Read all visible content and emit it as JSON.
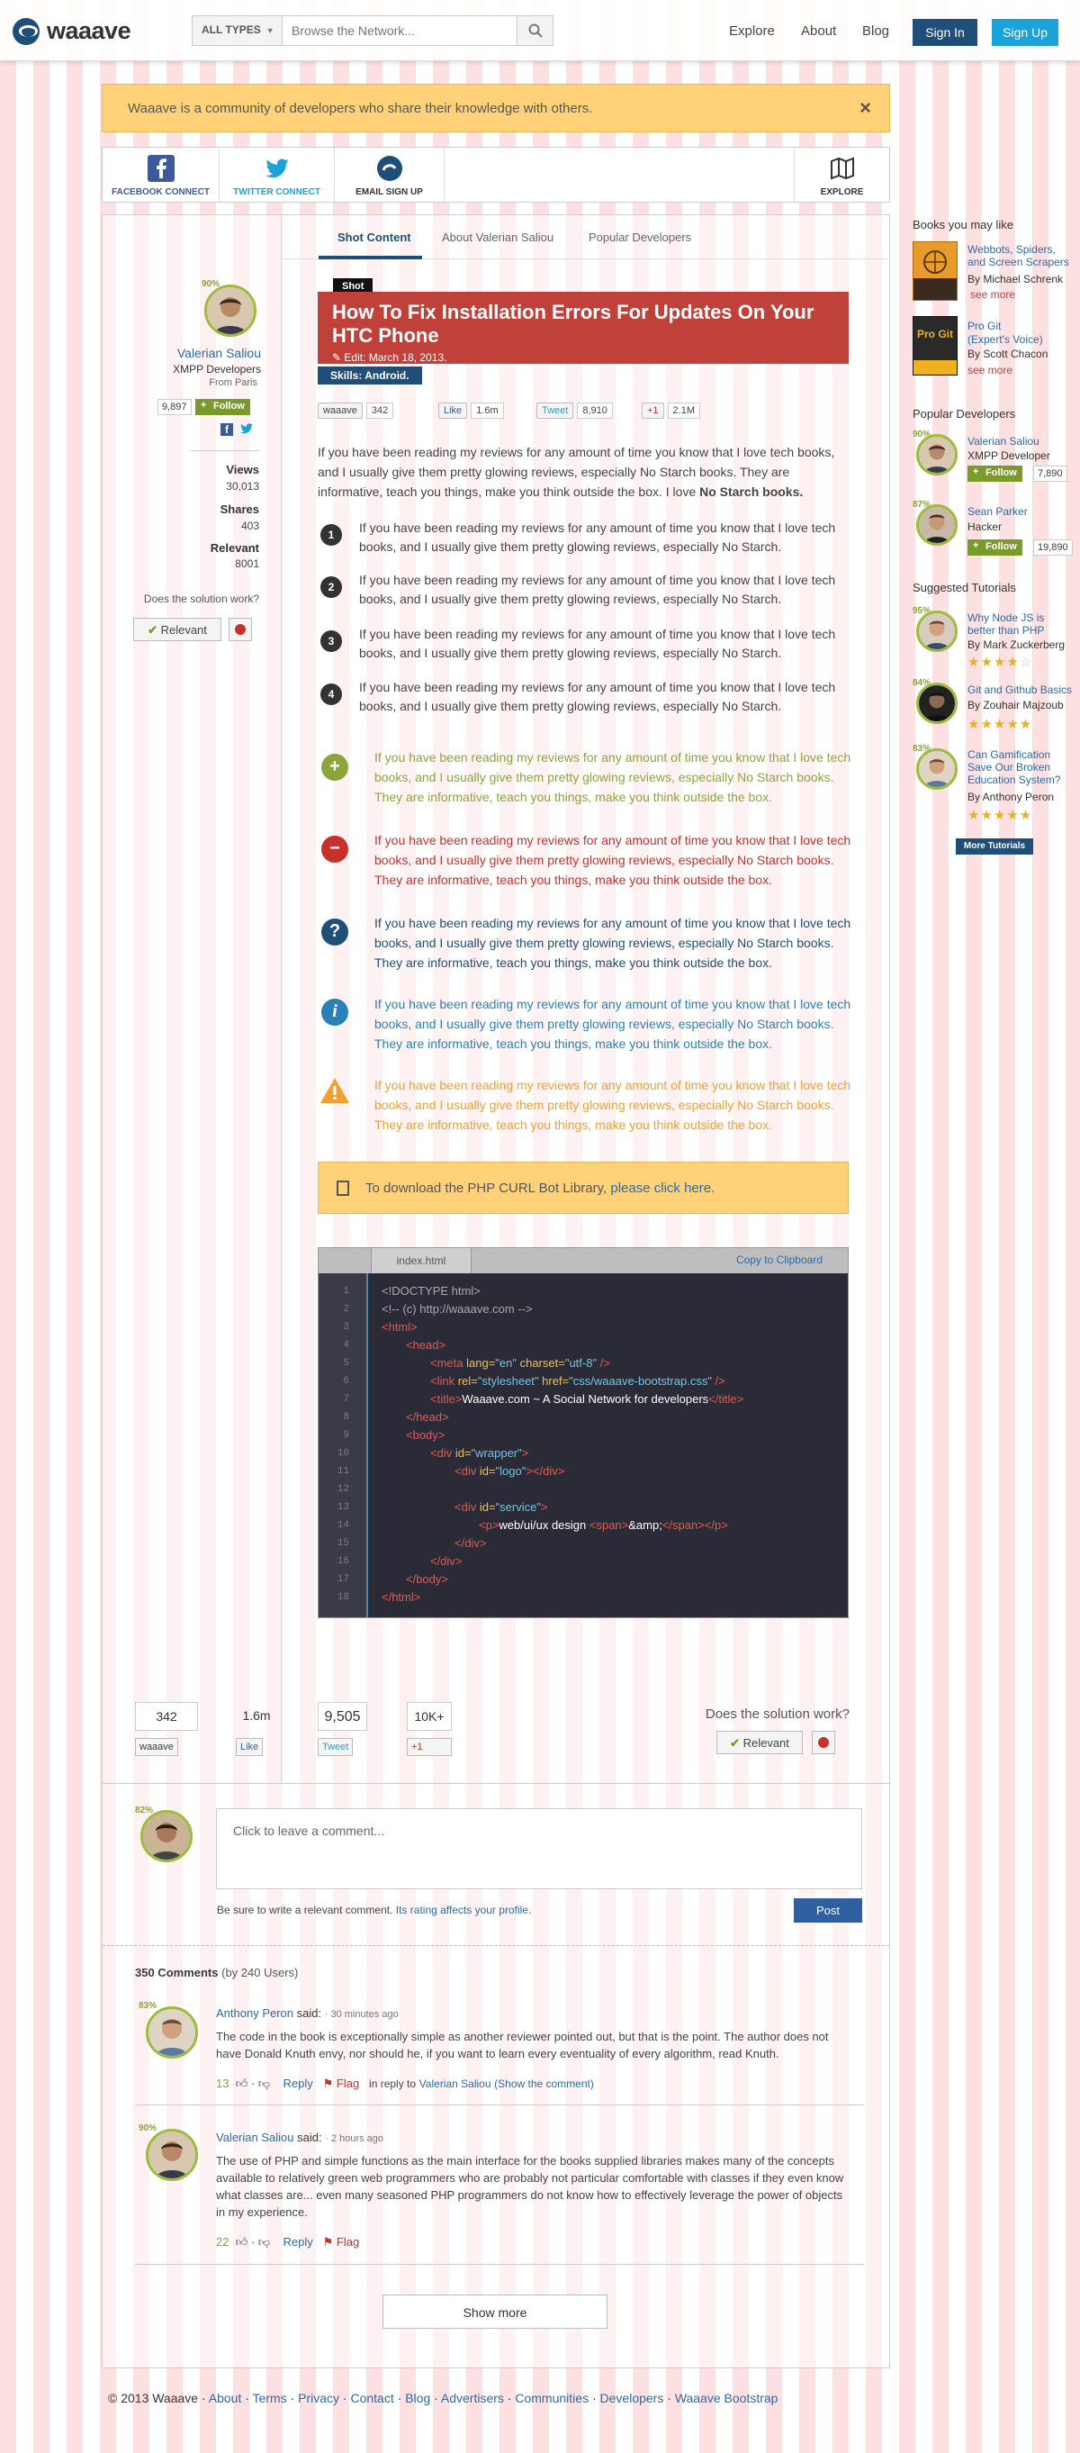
{
  "header": {
    "logo_text": "waaave",
    "search_type": "ALL TYPES",
    "search_placeholder": "Browse the Network...",
    "nav": [
      "Explore",
      "About",
      "Blog"
    ],
    "signin": "Sign In",
    "signup": "Sign Up"
  },
  "banner": {
    "text": "Waaave is a community of developers who share their knowledge with others.",
    "close": "×"
  },
  "social": {
    "facebook": "FACEBOOK CONNECT",
    "twitter": "TWITTER CONNECT",
    "email": "EMAIL SIGN UP",
    "explore": "EXPLORE"
  },
  "tabs": [
    "Shot Content",
    "About Valerian Saliou",
    "Popular Developers"
  ],
  "author": {
    "pct": "90%",
    "name": "Valerian Saliou",
    "company": "XMPP Developers",
    "location": "From Paris",
    "followers": "9,897",
    "follow": "Follow"
  },
  "stats": [
    {
      "label": "Views",
      "value": "30,013"
    },
    {
      "label": "Shares",
      "value": "403"
    },
    {
      "label": "Relevant",
      "value": "8001"
    }
  ],
  "solution": {
    "question": "Does the solution work?",
    "relevant": "Relevant"
  },
  "article": {
    "badge": "Shot",
    "title": "How To Fix Installation Errors For Updates On Your HTC Phone",
    "edit": "Edit: March 18, 2013.",
    "skills": "Skills: Android.",
    "counters": [
      {
        "label": "waaave",
        "count": "342"
      },
      {
        "label": "Like",
        "count": "1.6m"
      },
      {
        "label": "Tweet",
        "count": "8,910"
      },
      {
        "label": "+1",
        "count": "2.1M"
      }
    ],
    "intro": "If you have been reading my reviews for any amount of time you know that I love tech books, and I usually give them pretty glowing reviews, especially No Starch books. They are informative, teach you things, make you think outside the box. I love",
    "intro_bold": "No Starch books.",
    "numbered": [
      {
        "n": "1",
        "text": "If you have been reading my reviews for any amount of time you know that I love tech books, and I usually give them pretty glowing reviews, especially No Starch."
      },
      {
        "n": "2",
        "text": "If you have been reading my reviews for any amount of time you know that I love tech books, and I usually give them pretty glowing reviews, especially No Starch."
      },
      {
        "n": "3",
        "text": "If you have been reading my reviews for any amount of time you know that I love tech books, and I usually give them pretty glowing reviews, especially No Starch."
      },
      {
        "n": "4",
        "text": "If you have been reading my reviews for any amount of time you know that I love tech books, and I usually give them pretty glowing reviews, especially No Starch."
      }
    ],
    "callouts": [
      {
        "icon": "plus-icon",
        "color": "#8aa63a",
        "text": "If you have been reading my reviews for any amount of time you know that I love tech books, and I usually give them pretty glowing reviews, especially No Starch books. They are informative, teach you things, make you think outside the box."
      },
      {
        "icon": "minus-icon",
        "color": "#c8302b",
        "text": "If you have been reading my reviews for any amount of time you know that I love tech books, and I usually give them pretty glowing reviews, especially No Starch books. They are informative, teach you things, make you think outside the box."
      },
      {
        "icon": "question-icon",
        "color": "#1f4e79",
        "text": "If you have been reading my reviews for any amount of time you know that I love tech books, and I usually give them pretty glowing reviews, especially No Starch books. They are informative, teach you things, make you think outside the box."
      },
      {
        "icon": "info-icon",
        "color": "#2a80b9",
        "text": "If you have been reading my reviews for any amount of time you know that I love tech books, and I usually give them pretty glowing reviews, especially No Starch books. They are informative, teach you things, make you think outside the box."
      },
      {
        "icon": "warning-icon",
        "color": "#f0a030",
        "text": "If you have been reading my reviews for any amount of time you know that I love tech books, and I usually give them pretty glowing reviews, especially No Starch books. They are informative, teach you things, make you think outside the box."
      }
    ],
    "download_text": "To download the PHP CURL Bot Library,",
    "download_link": "please click here."
  },
  "code": {
    "tab": "index.html",
    "copy": "Copy to Clipboard",
    "lines": [
      "1",
      "2",
      "3",
      "4",
      "5",
      "6",
      "7",
      "8",
      "9",
      "10",
      "11",
      "12",
      "13",
      "14",
      "15",
      "16",
      "17",
      "18"
    ],
    "c1": "<!DOCTYPE html>",
    "c2": "<!-- (c) http://waaave.com -->",
    "c3": "<html>",
    "c4": "<head>",
    "c5a": "<meta ",
    "c5b": "lang=",
    "c5c": "\"en\" ",
    "c5d": "charset=",
    "c5e": "\"utf-8\"",
    "c5f": " />",
    "c6a": "<link ",
    "c6b": "rel=",
    "c6c": "\"stylesheet\" ",
    "c6d": "href=",
    "c6e": "\"css/waaave-bootstrap.css\"",
    "c6f": " />",
    "c7a": "<title>",
    "c7b": "Waaave.com ~ A Social Network for developers",
    "c7c": "</title>",
    "c8": "</head>",
    "c9": "<body>",
    "c10a": "<div ",
    "c10b": "id=",
    "c10c": "\"wrapper\"",
    "c10d": ">",
    "c11a": "<div ",
    "c11b": "id=",
    "c11c": "\"logo\"",
    "c11d": "></div>",
    "c13a": "<div ",
    "c13b": "id=",
    "c13c": "\"service\"",
    "c13d": ">",
    "c14a": "<p>",
    "c14b": "web/ui/ux design ",
    "c14c": "<span>",
    "c14d": "&amp;",
    "c14e": "</span></p>",
    "c15": "</div>",
    "c16": "</div>",
    "c17": "</body>",
    "c18": "</html>"
  },
  "bottom_share": [
    {
      "count": "342",
      "label": "waaave"
    },
    {
      "count": "1.6m",
      "label": "Like"
    },
    {
      "count": "9,505",
      "label": "Tweet"
    },
    {
      "count": "10K+",
      "label": "+1"
    }
  ],
  "comment_form": {
    "pct": "82%",
    "placeholder": "Click to leave a comment...",
    "note": "Be sure to write a relevant comment.",
    "note_link": "Its rating affects your profile.",
    "post": "Post"
  },
  "comments_header": {
    "count": "350 Comments",
    "users": "(by 240 Users)"
  },
  "comments": [
    {
      "pct": "83%",
      "name": "Anthony Peron",
      "said": "said:",
      "time": "30 minutes ago",
      "body": "The code in the book is exceptionally simple as another reviewer pointed out, but that is the point. The author does not have Donald Knuth envy, nor should he, if you want to learn every eventuality of every algorithm, read Knuth.",
      "votes": "13",
      "reply": "Reply",
      "flag": "Flag",
      "in_reply": "in reply to",
      "reply_to": "Valerian Saliou",
      "show": "(Show the comment)"
    },
    {
      "pct": "90%",
      "name": "Valerian Saliou",
      "said": "said:",
      "time": "2 hours ago",
      "body": "The use of PHP and simple functions as the main interface for the books supplied libraries makes many of the concepts available to relatively green web programmers who are probably not particular comfortable with classes if they even know what classes are... even many seasoned PHP programmers do not know how to effectively leverage the power of objects in my experience.",
      "votes": "22",
      "reply": "Reply",
      "flag": "Flag"
    }
  ],
  "show_more": "Show more",
  "sidebar": {
    "books_title": "Books you may like",
    "books": [
      {
        "title": "Webbots, Spiders, and Screen Scrapers",
        "author": "By Michael Schrenk",
        "more": "see more",
        "cover_color": "#e89a2a"
      },
      {
        "title": "Pro Git",
        "subtitle": "(Expert's Voice)",
        "author": "By Scott Chacon",
        "more": "see more",
        "cover_color": "#2a2a2a"
      }
    ],
    "devs_title": "Popular Developers",
    "devs": [
      {
        "pct": "90%",
        "name": "Valerian Saliou",
        "role": "XMPP Developer",
        "follow": "Follow",
        "count": "7,890"
      },
      {
        "pct": "87%",
        "name": "Sean Parker",
        "role": "Hacker",
        "follow": "Follow",
        "count": "19,890"
      }
    ],
    "tutorials_title": "Suggested Tutorials",
    "tutorials": [
      {
        "pct": "95%",
        "title": "Why Node JS is better than PHP",
        "author": "By Mark Zuckerberg",
        "rating": 4.5
      },
      {
        "pct": "84%",
        "title": "Git and Github Basics",
        "author": "By Zouhair Majzoub",
        "rating": 5
      },
      {
        "pct": "83%",
        "title": "Can Gamification Save Our Broken Education System?",
        "author": "By Anthony Peron",
        "rating": 5
      }
    ],
    "more_tutorials": "More Tutorials"
  },
  "footer": {
    "copyright": "© 2013 Waaave",
    "links": [
      "About",
      "Terms",
      "Privacy",
      "Contact",
      "Blog",
      "Advertisers",
      "Communities",
      "Developers",
      "Waaave Bootstrap"
    ]
  },
  "colors": {
    "brand": "#1f4e79",
    "accent": "#1aa3d9",
    "title_red": "#c0403a",
    "banner": "#ffd27a"
  }
}
